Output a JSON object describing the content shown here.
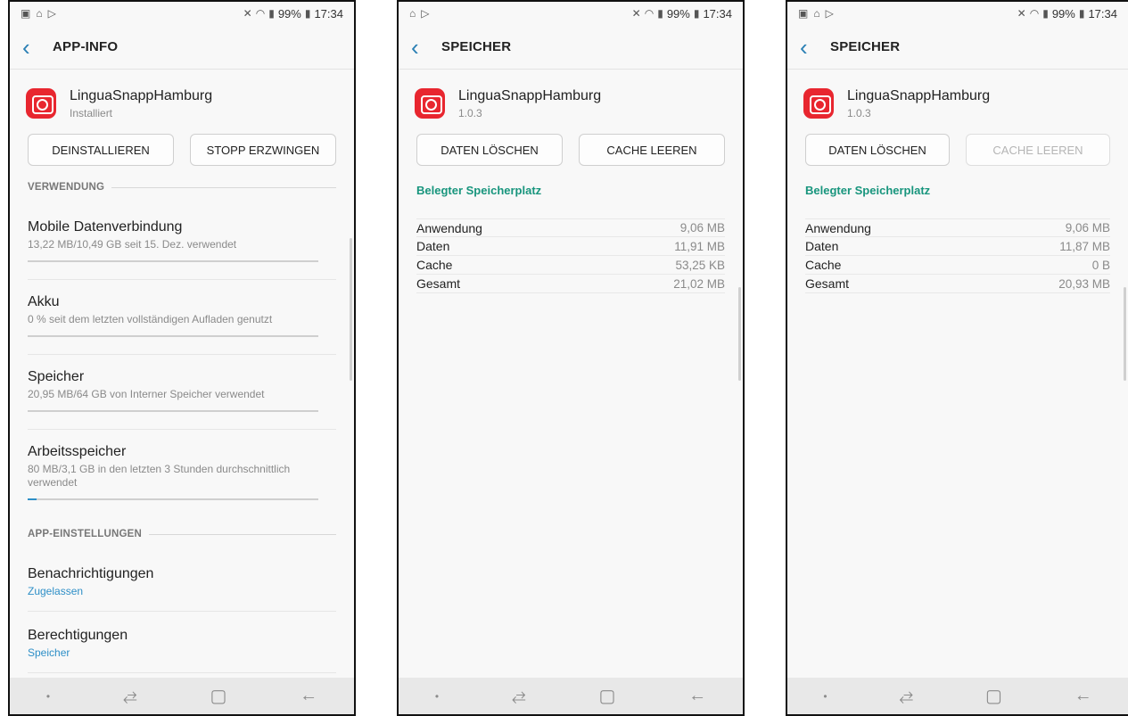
{
  "status": {
    "battery": "99%",
    "time": "17:34"
  },
  "phone1": {
    "title": "APP-INFO",
    "app": {
      "name": "LinguaSnappHamburg",
      "sub": "Installiert"
    },
    "buttons": {
      "uninstall": "DEINSTALLIEREN",
      "force_stop": "STOPP ERZWINGEN"
    },
    "usage_section": "VERWENDUNG",
    "items": [
      {
        "title": "Mobile Datenverbindung",
        "sub": "13,22 MB/10,49 GB seit 15. Dez. verwendet",
        "progress": 0.0
      },
      {
        "title": "Akku",
        "sub": "0 % seit dem letzten vollständigen Aufladen genutzt",
        "progress": 0.0
      },
      {
        "title": "Speicher",
        "sub": "20,95 MB/64 GB von Interner Speicher verwendet",
        "progress": 0.0
      },
      {
        "title": "Arbeitsspeicher",
        "sub": "80 MB/3,1 GB in den letzten 3 Stunden durchschnittlich verwendet",
        "progress": 0.03
      }
    ],
    "settings_section": "APP-EINSTELLUNGEN",
    "settings": [
      {
        "title": "Benachrichtigungen",
        "sub": "Zugelassen"
      },
      {
        "title": "Berechtigungen",
        "sub": "Speicher"
      }
    ]
  },
  "phone2": {
    "title": "SPEICHER",
    "app": {
      "name": "LinguaSnappHamburg",
      "version": "1.0.3"
    },
    "buttons": {
      "clear_data": "DATEN LÖSCHEN",
      "clear_cache": "CACHE LEEREN"
    },
    "storage_head": "Belegter Speicherplatz",
    "rows": [
      {
        "label": "Anwendung",
        "value": "9,06 MB"
      },
      {
        "label": "Daten",
        "value": "11,91 MB"
      },
      {
        "label": "Cache",
        "value": "53,25 KB"
      },
      {
        "label": "Gesamt",
        "value": "21,02 MB"
      }
    ]
  },
  "phone3": {
    "title": "SPEICHER",
    "app": {
      "name": "LinguaSnappHamburg",
      "version": "1.0.3"
    },
    "buttons": {
      "clear_data": "DATEN LÖSCHEN",
      "clear_cache": "CACHE LEEREN"
    },
    "storage_head": "Belegter Speicherplatz",
    "rows": [
      {
        "label": "Anwendung",
        "value": "9,06 MB"
      },
      {
        "label": "Daten",
        "value": "11,87 MB"
      },
      {
        "label": "Cache",
        "value": "0 B"
      },
      {
        "label": "Gesamt",
        "value": "20,93 MB"
      }
    ]
  },
  "colors": {
    "accent_blue": "#2e8fc7",
    "accent_teal": "#18957d",
    "app_icon_red": "#e8262f"
  },
  "icons": {
    "back": "back-arrow-icon",
    "app": "camera-app-icon"
  }
}
